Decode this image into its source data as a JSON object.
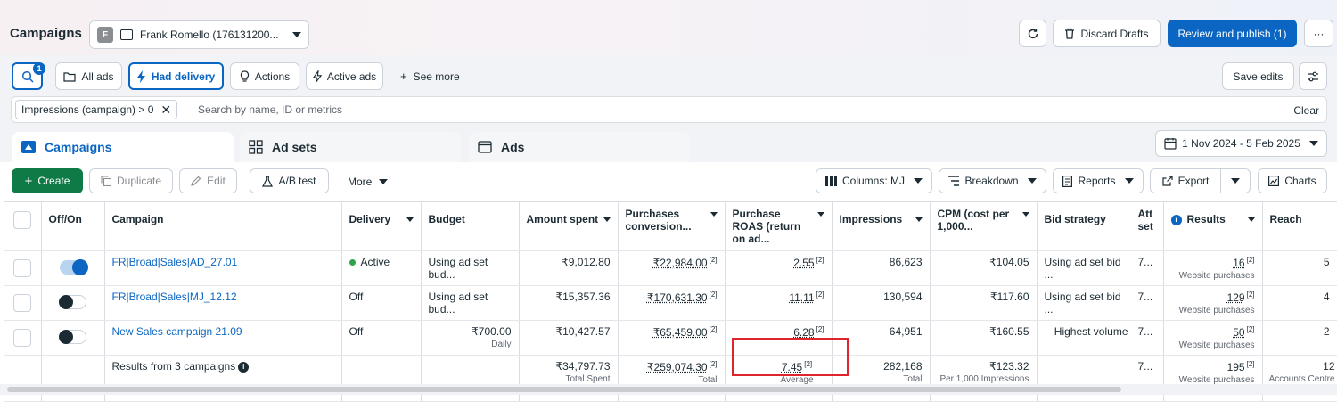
{
  "header": {
    "title": "Campaigns",
    "account": {
      "avatar": "F",
      "name": "Frank Romello (176131200..."
    },
    "discard_label": "Discard Drafts",
    "review_label": "Review and publish (1)",
    "more_label": "···"
  },
  "toolbar": {
    "search_badge": "1",
    "all_ads": "All ads",
    "had_delivery": "Had delivery",
    "actions": "Actions",
    "active_ads": "Active ads",
    "see_more": "See more",
    "save_edits": "Save edits"
  },
  "filter": {
    "chip": "Impressions (campaign) > 0",
    "placeholder": "Search by name, ID or metrics",
    "clear": "Clear"
  },
  "tabs": [
    {
      "label": "Campaigns"
    },
    {
      "label": "Ad sets"
    },
    {
      "label": "Ads"
    }
  ],
  "date_range": "1 Nov 2024 - 5 Feb 2025",
  "actionbar": {
    "create": "Create",
    "duplicate": "Duplicate",
    "edit": "Edit",
    "ab_test": "A/B test",
    "more": "More",
    "columns": "Columns: MJ",
    "breakdown": "Breakdown",
    "reports": "Reports",
    "export": "Export",
    "charts": "Charts"
  },
  "table": {
    "headers": {
      "offon": "Off/On",
      "campaign": "Campaign",
      "delivery": "Delivery",
      "budget": "Budget",
      "amount": "Amount spent",
      "purchases_cv": "Purchases conversion...",
      "roas": "Purchase ROAS (return on ad...",
      "impressions": "Impressions",
      "cpm": "CPM (cost per 1,000...",
      "bid": "Bid strategy",
      "att": "Att set",
      "results": "Results",
      "reach": "Reach"
    },
    "rows": [
      {
        "on": true,
        "campaign": "FR|Broad|Sales|AD_27.01",
        "delivery": "Active",
        "budget": "Using ad set bud...",
        "budget_sub": "",
        "amount": "₹9,012.80",
        "purchases_cv": "₹22,984.00",
        "roas": "2.55",
        "impressions": "86,623",
        "cpm": "₹104.05",
        "bid": "Using ad set bid ...",
        "att": "7...",
        "results": "16",
        "results_sub": "Website purchases",
        "reach": "5"
      },
      {
        "on": false,
        "campaign": "FR|Broad|Sales|MJ_12.12",
        "delivery": "Off",
        "budget": "Using ad set bud...",
        "budget_sub": "",
        "amount": "₹15,357.36",
        "purchases_cv": "₹170,631.30",
        "roas": "11.11",
        "impressions": "130,594",
        "cpm": "₹117.60",
        "bid": "Using ad set bid ...",
        "att": "7...",
        "results": "129",
        "results_sub": "Website purchases",
        "reach": "4"
      },
      {
        "on": false,
        "campaign": "New Sales campaign 21.09",
        "delivery": "Off",
        "budget": "₹700.00",
        "budget_sub": "Daily",
        "amount": "₹10,427.57",
        "purchases_cv": "₹65,459.00",
        "roas": "6.28",
        "impressions": "64,951",
        "cpm": "₹160.55",
        "bid": "Highest volume",
        "att": "7...",
        "results": "50",
        "results_sub": "Website purchases",
        "reach": "2"
      }
    ],
    "summary": {
      "label": "Results from 3 campaigns",
      "amount": "₹34,797.73",
      "amount_sub": "Total Spent",
      "purchases_cv": "₹259,074.30",
      "purchases_cv_sub": "Total",
      "roas": "7.45",
      "roas_sub": "Average",
      "impressions": "282,168",
      "impressions_sub": "Total",
      "cpm": "₹123.32",
      "cpm_sub": "Per 1,000 Impressions",
      "att": "7...",
      "results": "195",
      "results_sub": "Website purchases",
      "reach": "12",
      "reach_sub": "Accounts Centre"
    },
    "footnote_marker": "[2]"
  },
  "icons": {
    "refresh": "refresh-icon",
    "trash": "trash-icon",
    "search": "search-icon",
    "folder": "folder-icon",
    "bolt": "bolt-icon",
    "bulb": "lightbulb-icon",
    "plus": "plus-icon",
    "settings": "sliders-icon",
    "calendar": "calendar-icon"
  },
  "colors": {
    "primary": "#0a66c2",
    "create": "#0e7a45",
    "active_dot": "#31a24c",
    "highlight": "#e0242b"
  }
}
